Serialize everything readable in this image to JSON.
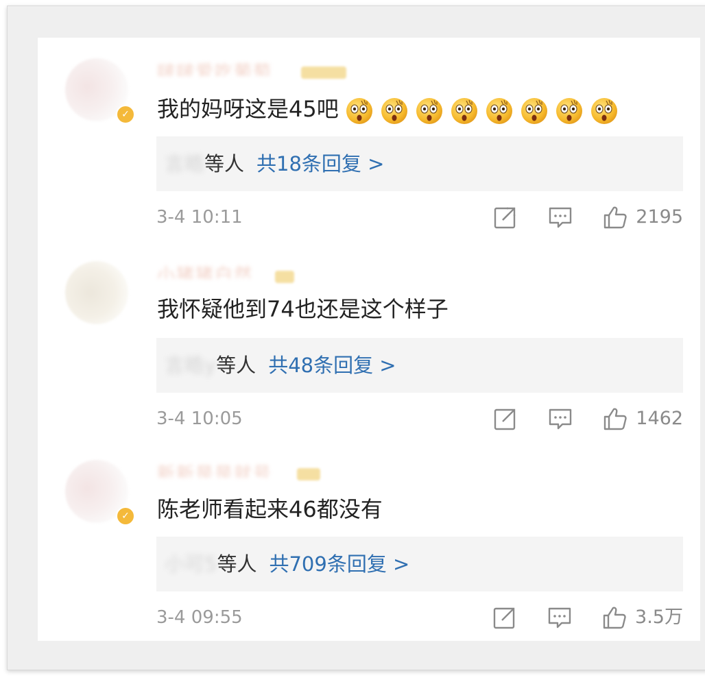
{
  "comments": [
    {
      "username": "啵啵爱吃葡萄",
      "text": "我的妈呀这是45吧",
      "emoji_icon": "astonished-face-emoji",
      "emoji_count": 8,
      "replier": "言皓",
      "replier_suffix": "等人",
      "reply_count_label": "共18条回复 >",
      "time": "3-4 10:11",
      "likes": "2195",
      "verified": true
    },
    {
      "username": "小猪猪白然",
      "text": "我怀疑他到74也还是这个样子",
      "replier": "言皓y",
      "replier_suffix": "等人",
      "reply_count_label": "共48条回复 >",
      "time": "3-4 10:05",
      "likes": "1462",
      "verified": false
    },
    {
      "username": "新新是是就号",
      "text": "陈老师看起来46都没有",
      "replier": "小可5",
      "replier_suffix": "等人",
      "reply_count_label": "共709条回复 >",
      "time": "3-4 09:55",
      "likes": "3.5万",
      "verified": true
    }
  ],
  "colors": {
    "link": "#2f6fb1",
    "badge": "#f4b93a",
    "meta": "#9a9a9a",
    "reply_bg": "#f4f4f4"
  }
}
